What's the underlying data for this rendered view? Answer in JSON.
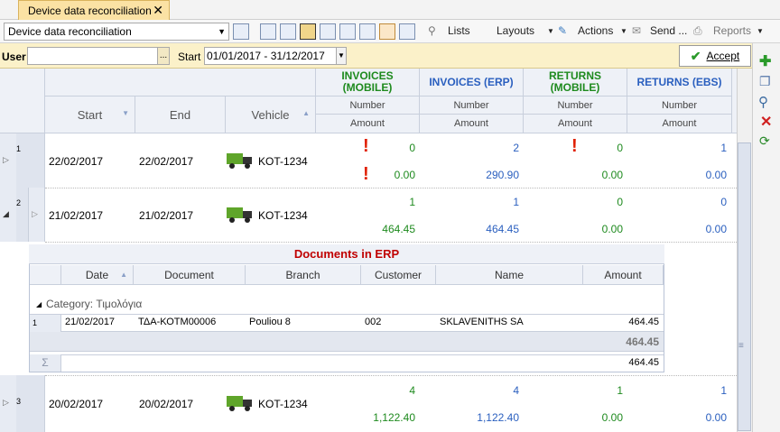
{
  "tab": {
    "title": "Device data reconciliation",
    "close": "✕"
  },
  "toolbar": {
    "view_select": "Device data reconciliation",
    "lists": "Lists",
    "layouts": "Layouts",
    "actions": "Actions",
    "send": "Send ...",
    "reports": "Reports"
  },
  "params": {
    "user_label": "User",
    "user_value": "",
    "ellipsis": "...",
    "start_label": "Start",
    "start_value": "01/01/2017 - 31/12/2017",
    "accept": "Accept"
  },
  "grid": {
    "groups": {
      "inv_mobile": "INVOICES (MOBILE)",
      "inv_erp": "INVOICES (ERP)",
      "ret_mobile": "RETURNS (MOBILE)",
      "ret_ebs": "RETURNS (EBS)"
    },
    "sub_number": "Number",
    "sub_amount": "Amount",
    "columns": {
      "start": "Start",
      "end": "End",
      "vehicle": "Vehicle"
    },
    "rows": [
      {
        "num": "1",
        "start": "22/02/2017",
        "end": "22/02/2017",
        "vehicle": "KOT-1234",
        "inv_mobile_num": "0",
        "inv_mobile_amt": "0.00",
        "inv_erp_num": "2",
        "inv_erp_amt": "290.90",
        "ret_mobile_num": "0",
        "ret_mobile_amt": "0.00",
        "ret_ebs_num": "1",
        "ret_ebs_amt": "0.00"
      },
      {
        "num": "2",
        "start": "21/02/2017",
        "end": "21/02/2017",
        "vehicle": "KOT-1234",
        "inv_mobile_num": "1",
        "inv_mobile_amt": "464.45",
        "inv_erp_num": "1",
        "inv_erp_amt": "464.45",
        "ret_mobile_num": "0",
        "ret_mobile_amt": "0.00",
        "ret_ebs_num": "0",
        "ret_ebs_amt": "0.00"
      },
      {
        "num": "3",
        "start": "20/02/2017",
        "end": "20/02/2017",
        "vehicle": "KOT-1234",
        "inv_mobile_num": "4",
        "inv_mobile_amt": "1,122.40",
        "inv_erp_num": "4",
        "inv_erp_amt": "1,122.40",
        "ret_mobile_num": "1",
        "ret_mobile_amt": "0.00",
        "ret_ebs_num": "1",
        "ret_ebs_amt": "0.00"
      }
    ]
  },
  "detail": {
    "title": "Documents in ERP",
    "columns": {
      "date": "Date",
      "document": "Document",
      "branch": "Branch",
      "customer": "Customer",
      "name": "Name",
      "amount": "Amount"
    },
    "category": "Category: Τιμολόγια",
    "row": {
      "num": "1",
      "date": "21/02/2017",
      "document": "ΤΔΑ-ΚΟΤΜ00006",
      "branch": "Pouliou 8",
      "customer": "002",
      "name": "SKLAVENITHS SA",
      "amount": "464.45"
    },
    "group_total": "464.45",
    "sigma": "Σ",
    "grand_total": "464.45"
  },
  "colors": {
    "accent_tab": "#fbe2a4",
    "green": "#1e8a1e",
    "blue": "#2a5fbf",
    "alert": "#e02000",
    "detail_title": "#c00000"
  }
}
